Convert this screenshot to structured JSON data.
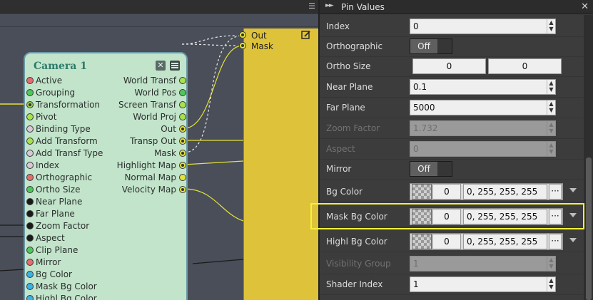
{
  "graph": {
    "node": {
      "title": "Camera 1",
      "left_pins": [
        {
          "label": "Active",
          "color": "#e46d6d",
          "link": false
        },
        {
          "label": "Grouping",
          "color": "#4fc85a",
          "link": false
        },
        {
          "label": "Transformation",
          "color": "#9ad24b",
          "link": true
        },
        {
          "label": "Pivot",
          "color": "#a6e24c",
          "link": false
        },
        {
          "label": "Binding Type",
          "color": "#d8c8d6",
          "link": false
        },
        {
          "label": "Add Transform",
          "color": "#a6e24c",
          "link": false
        },
        {
          "label": "Add Transf Type",
          "color": "#d8c8d6",
          "link": false
        },
        {
          "label": "Index",
          "color": "#d8c8d6",
          "link": false
        },
        {
          "label": "Orthographic",
          "color": "#e46d6d",
          "link": false
        },
        {
          "label": "Ortho Size",
          "color": "#4fc85a",
          "link": false
        },
        {
          "label": "Near Plane",
          "color": "#1a1a1a",
          "link": false
        },
        {
          "label": "Far Plane",
          "color": "#1a1a1a",
          "link": false
        },
        {
          "label": "Zoom Factor",
          "color": "#1a1a1a",
          "link": false
        },
        {
          "label": "Aspect",
          "color": "#1a1a1a",
          "link": false
        },
        {
          "label": "Clip Plane",
          "color": "#4fc85a",
          "link": false
        },
        {
          "label": "Mirror",
          "color": "#e46d6d",
          "link": false
        },
        {
          "label": "Bg Color",
          "color": "#3ab3e0",
          "link": false
        },
        {
          "label": "Mask Bg Color",
          "color": "#3ab3e0",
          "link": false
        },
        {
          "label": "Highl Bg Color",
          "color": "#3ab3e0",
          "link": false
        }
      ],
      "right_pins": [
        {
          "label": "World Transf",
          "color": "#a6e24c",
          "link": false
        },
        {
          "label": "World Pos",
          "color": "#4fc85a",
          "link": false
        },
        {
          "label": "Screen Transf",
          "color": "#a6e24c",
          "link": false
        },
        {
          "label": "World Proj",
          "color": "#a6e24c",
          "link": false
        },
        {
          "label": "Out",
          "color": "#e3e23a",
          "link": true
        },
        {
          "label": "Transp Out",
          "color": "#e3e23a",
          "link": true
        },
        {
          "label": "Mask",
          "color": "#e3e23a",
          "link": true
        },
        {
          "label": "Highlight Map",
          "color": "#e3e23a",
          "link": true
        },
        {
          "label": "Normal Map",
          "color": "#e3e23a",
          "link": false
        },
        {
          "label": "Velocity Map",
          "color": "#e3e23a",
          "link": true
        }
      ]
    },
    "output_node": {
      "pins": [
        {
          "label": "Out"
        },
        {
          "label": "Mask"
        }
      ]
    }
  },
  "panel": {
    "title": "Pin Values",
    "rows": [
      {
        "label": "Index",
        "kind": "number",
        "value": "0",
        "disabled": false
      },
      {
        "label": "Orthographic",
        "kind": "toggle",
        "value": "Off",
        "disabled": false
      },
      {
        "label": "Ortho Size",
        "kind": "split",
        "value": "0",
        "value2": "0",
        "disabled": false
      },
      {
        "label": "Near Plane",
        "kind": "number",
        "value": "0.1",
        "disabled": false
      },
      {
        "label": "Far Plane",
        "kind": "number",
        "value": "5000",
        "disabled": false
      },
      {
        "label": "Zoom Factor",
        "kind": "number",
        "value": "1.732",
        "disabled": true
      },
      {
        "label": "Aspect",
        "kind": "number",
        "value": "0",
        "disabled": true
      },
      {
        "label": "Mirror",
        "kind": "toggle",
        "value": "Off",
        "disabled": false
      },
      {
        "label": "Bg Color",
        "kind": "color",
        "value": "0",
        "rgb": "0, 255, 255, 255",
        "disabled": false
      },
      {
        "label": "Mask Bg Color",
        "kind": "color",
        "value": "0",
        "rgb": "0, 255, 255, 255",
        "disabled": false
      },
      {
        "label": "Highl Bg Color",
        "kind": "color",
        "value": "0",
        "rgb": "0, 255, 255, 255",
        "disabled": false
      },
      {
        "label": "Visibility Group",
        "kind": "number",
        "value": "1",
        "disabled": true
      },
      {
        "label": "Shader Index",
        "kind": "number",
        "value": "1",
        "disabled": false
      }
    ]
  },
  "colors": {
    "highlight": "#f3f23a",
    "wire": "#e3e23a",
    "node_bg": "#c2e4cb",
    "output_node_bg": "#dec23a"
  },
  "icons": {
    "close": "close-icon",
    "menu": "hamburger-icon",
    "edit": "edit-icon",
    "panel_collapse": "double-arrow-icon",
    "dropdown": "chevron-down-icon",
    "spin": "spinner-arrows-icon"
  }
}
